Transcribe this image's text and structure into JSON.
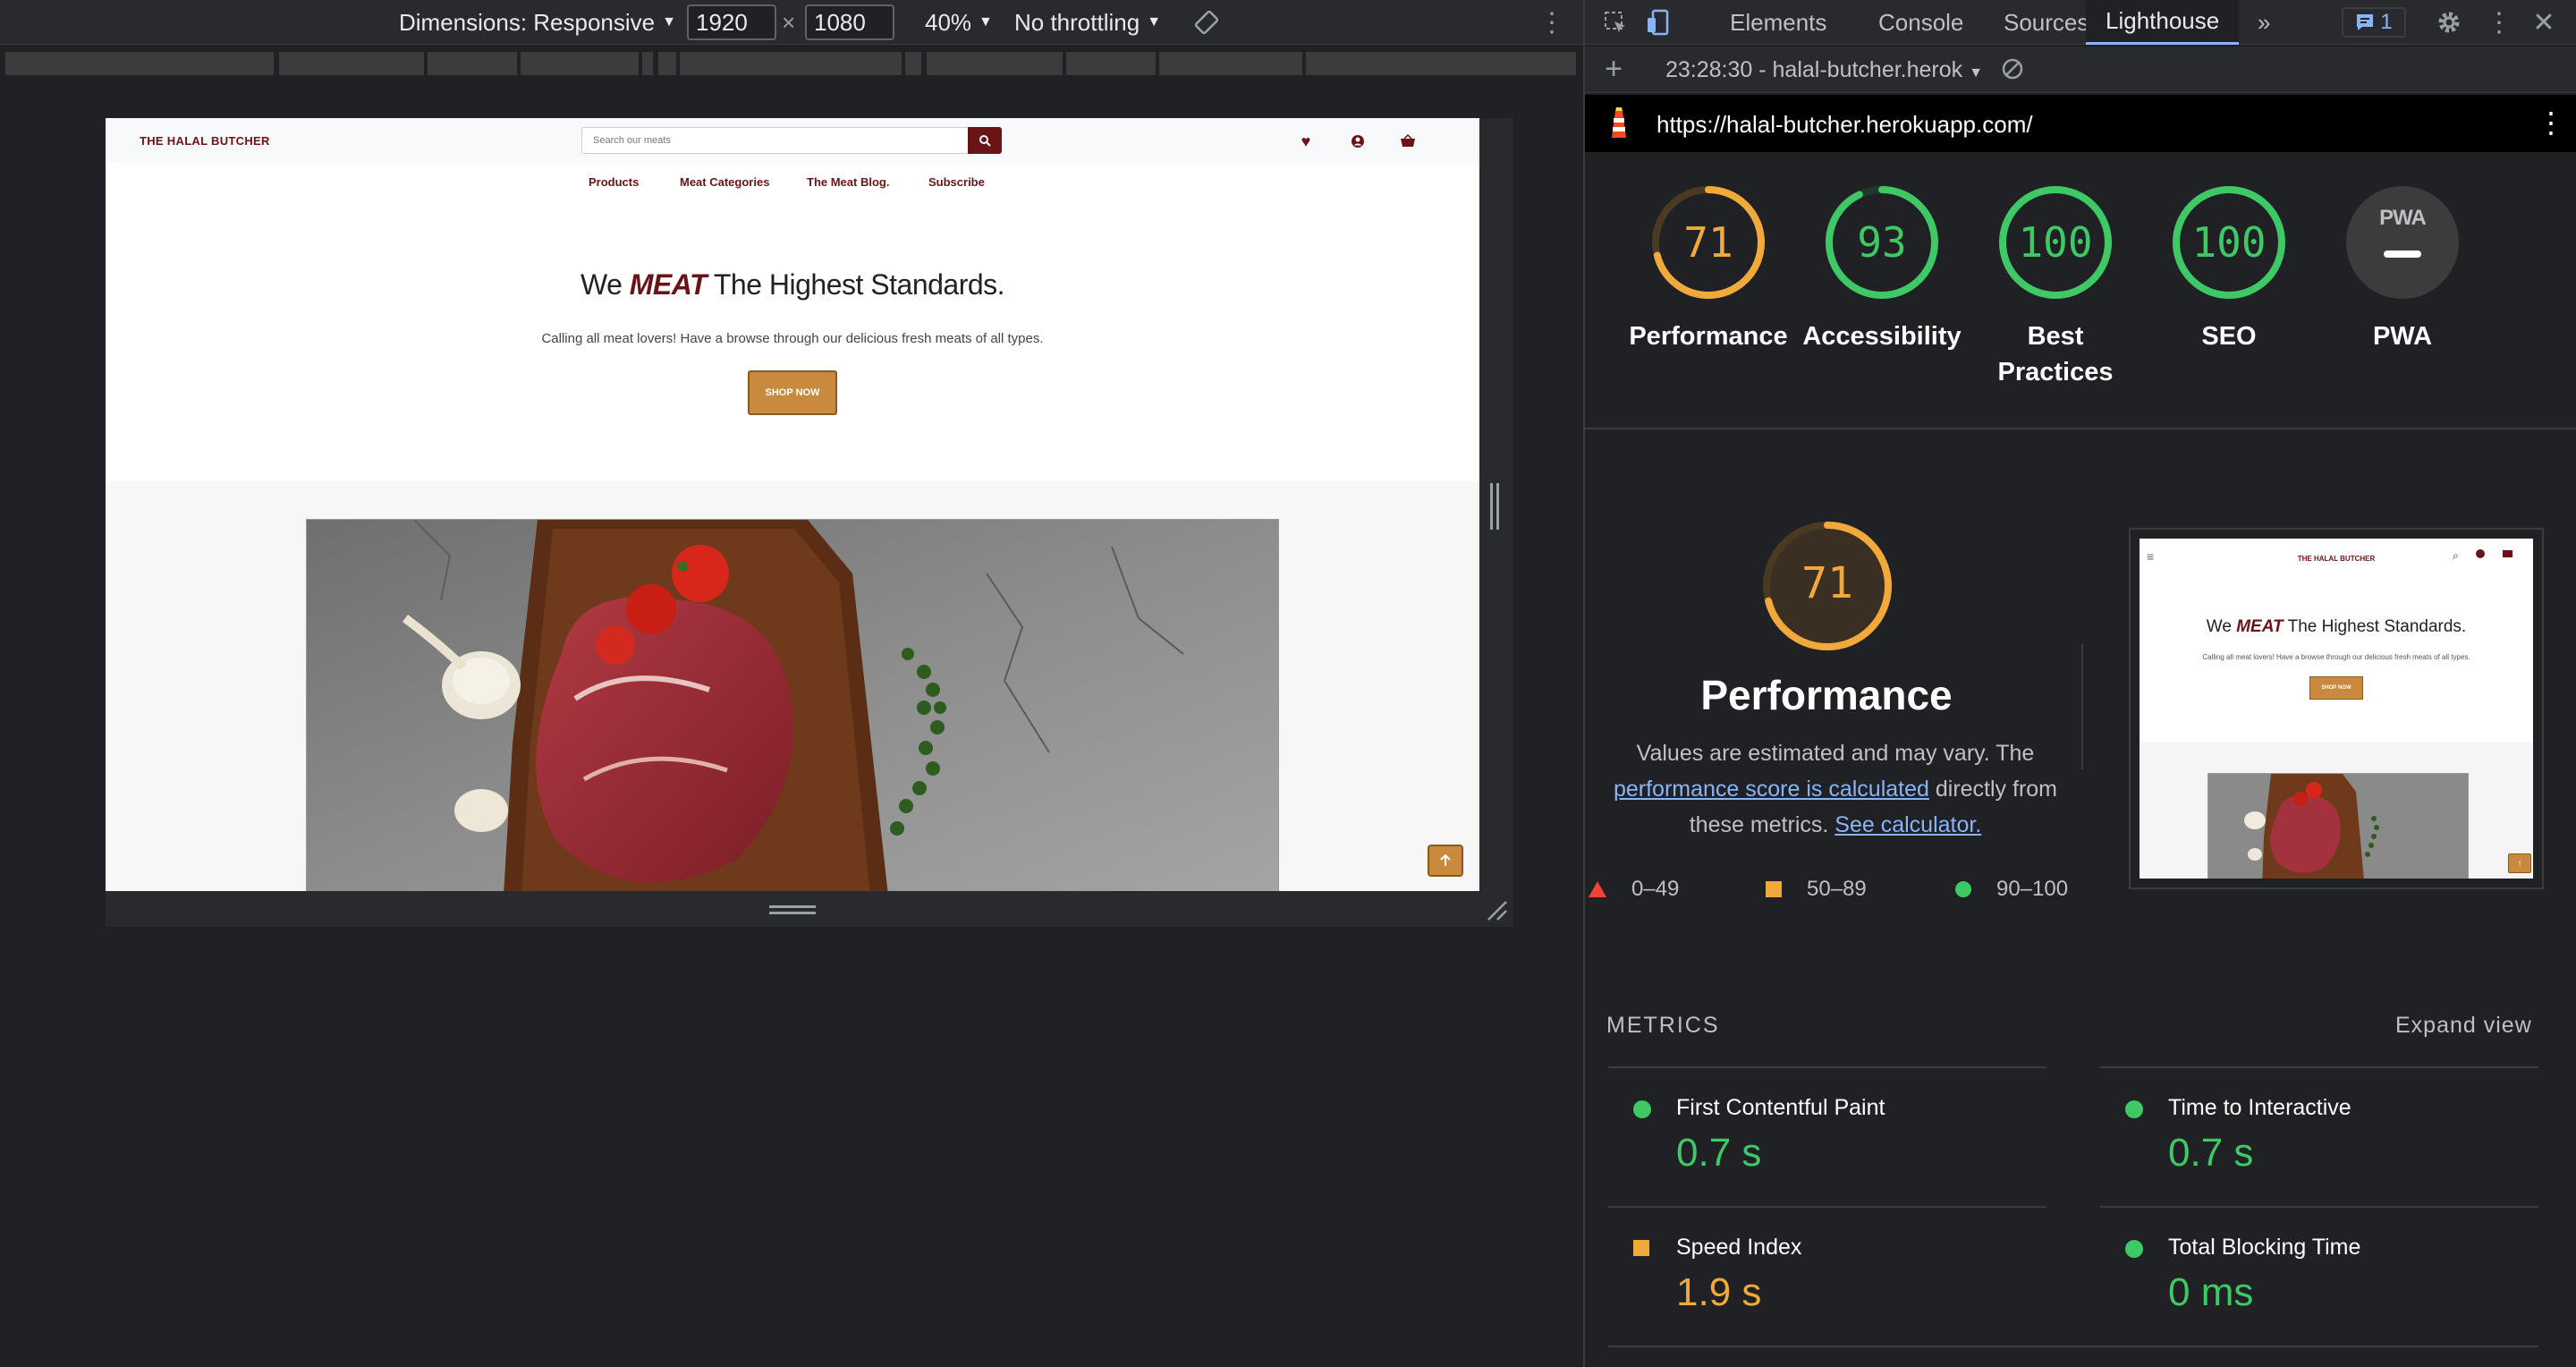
{
  "device_toolbar": {
    "dimensions_label": "Dimensions: Responsive",
    "width": "1920",
    "times": "×",
    "height": "1080",
    "zoom": "40%",
    "throttling": "No throttling"
  },
  "site": {
    "logo": "THE HALAL BUTCHER",
    "search_placeholder": "Search our meats",
    "nav": [
      "Products",
      "Meat Categories",
      "The Meat Blog.",
      "Subscribe"
    ],
    "hero_title_pre": "We",
    "hero_title_em": "MEAT",
    "hero_title_post": "The Highest Standards.",
    "hero_sub": "Calling all meat lovers! Have a browse through our delicious fresh meats of all types.",
    "shop_now": "SHOP NOW"
  },
  "devtools": {
    "tabs": [
      "Elements",
      "Console",
      "Sources",
      "Lighthouse"
    ],
    "active_tab": "Lighthouse",
    "more": "»",
    "badge_count": "1",
    "report_label": "23:28:30 - halal-butcher.herok",
    "url": "https://halal-butcher.herokuapp.com/"
  },
  "lighthouse": {
    "scores": [
      {
        "label": "Performance",
        "value": "71",
        "score": 71,
        "color": "#f2a93b"
      },
      {
        "label": "Accessibility",
        "value": "93",
        "score": 93,
        "color": "#3fc866"
      },
      {
        "label": "Best Practices",
        "value": "100",
        "score": 100,
        "color": "#3fc866"
      },
      {
        "label": "SEO",
        "value": "100",
        "score": 100,
        "color": "#3fc866"
      },
      {
        "label": "PWA",
        "value": "PWA",
        "score": null,
        "color": "#9aa0a6"
      }
    ],
    "perf_score": "71",
    "perf_title": "Performance",
    "perf_desc_1": "Values are estimated and may vary. The",
    "perf_link_1": "performance score is calculated",
    "perf_desc_2": "directly from these metrics.",
    "perf_link_2": "See calculator.",
    "legend": [
      "0–49",
      "50–89",
      "90–100"
    ],
    "thumb": {
      "logo": "THE HALAL BUTCHER",
      "title_pre": "We",
      "title_em": "MEAT",
      "title_post": "The Highest Standards.",
      "sub": "Calling all meat lovers! Have a browse through our delicious fresh meats of all types.",
      "button": "SHOP NOW"
    },
    "metrics_heading": "METRICS",
    "expand_view": "Expand view",
    "metrics": [
      {
        "label": "First Contentful Paint",
        "value": "0.7 s",
        "status": "green"
      },
      {
        "label": "Time to Interactive",
        "value": "0.7 s",
        "status": "green"
      },
      {
        "label": "Speed Index",
        "value": "1.9 s",
        "status": "orange"
      },
      {
        "label": "Total Blocking Time",
        "value": "0 ms",
        "status": "green"
      }
    ]
  }
}
